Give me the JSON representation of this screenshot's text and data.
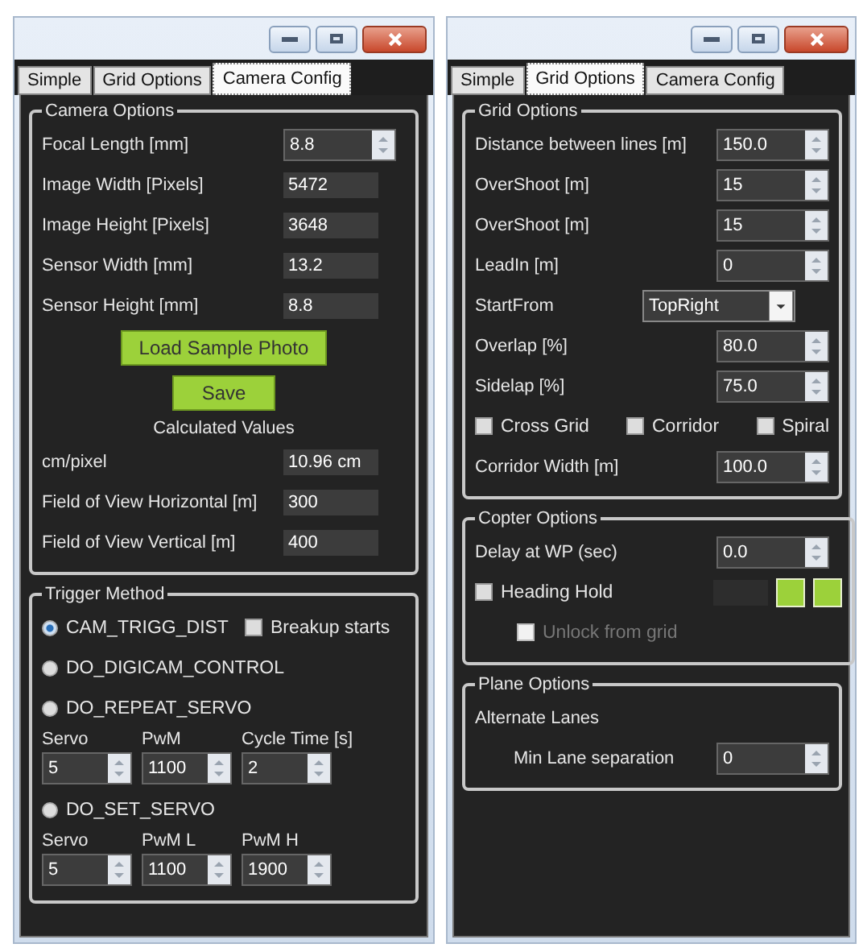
{
  "windows": [
    {
      "tabs": [
        {
          "label": "Simple",
          "selected": false
        },
        {
          "label": "Grid Options",
          "selected": false
        },
        {
          "label": "Camera Config",
          "selected": true
        }
      ],
      "groups": [
        {
          "title": "Camera Options",
          "rows": [
            {
              "kind": "spin",
              "label": "Focal Length [mm]",
              "value": "8.8"
            },
            {
              "kind": "field",
              "label": "Image Width [Pixels]",
              "value": "5472"
            },
            {
              "kind": "field",
              "label": "Image Height [Pixels]",
              "value": "3648"
            },
            {
              "kind": "field",
              "label": "Sensor Width [mm]",
              "value": "13.2"
            },
            {
              "kind": "field",
              "label": "Sensor Height [mm]",
              "value": "8.8"
            },
            {
              "kind": "button",
              "label": "Load Sample Photo"
            },
            {
              "kind": "button",
              "label": "Save"
            },
            {
              "kind": "caption",
              "label": "Calculated Values"
            },
            {
              "kind": "field",
              "label": "cm/pixel",
              "value": "10.96 cm"
            },
            {
              "kind": "field",
              "label": "Field of View Horizontal [m]",
              "value": "300"
            },
            {
              "kind": "field",
              "label": "Field of View Vertical [m]",
              "value": "400"
            }
          ]
        },
        {
          "title": "Trigger Method",
          "rows": [
            {
              "kind": "radio",
              "label": "CAM_TRIGG_DIST",
              "selected": true,
              "check": {
                "label": "Breakup starts",
                "checked": false
              }
            },
            {
              "kind": "radio",
              "label": "DO_DIGICAM_CONTROL",
              "selected": false
            },
            {
              "kind": "radio",
              "label": "DO_REPEAT_SERVO",
              "selected": false
            },
            {
              "kind": "spins",
              "items": [
                {
                  "label": "Servo",
                  "value": "5"
                },
                {
                  "label": "PwM",
                  "value": "1100"
                },
                {
                  "label": "Cycle Time [s]",
                  "value": "2"
                }
              ]
            },
            {
              "kind": "radio",
              "label": "DO_SET_SERVO",
              "selected": false
            },
            {
              "kind": "spins",
              "items": [
                {
                  "label": "Servo",
                  "value": "5"
                },
                {
                  "label": "PwM L",
                  "value": "1100"
                },
                {
                  "label": "PwM H",
                  "value": "1900"
                }
              ]
            }
          ]
        }
      ]
    },
    {
      "tabs": [
        {
          "label": "Simple",
          "selected": false
        },
        {
          "label": "Grid Options",
          "selected": true
        },
        {
          "label": "Camera Config",
          "selected": false
        }
      ],
      "groups": [
        {
          "title": "Grid Options",
          "rows": [
            {
              "kind": "spin",
              "label": "Distance between lines [m]",
              "value": "150.0"
            },
            {
              "kind": "spin",
              "label": "OverShoot [m]",
              "value": "15"
            },
            {
              "kind": "spin",
              "label": "OverShoot [m]",
              "value": "15"
            },
            {
              "kind": "spin",
              "label": "LeadIn [m]",
              "value": "0"
            },
            {
              "kind": "combo",
              "label": "StartFrom",
              "value": "TopRight"
            },
            {
              "kind": "spin",
              "label": "Overlap [%]",
              "value": "80.0"
            },
            {
              "kind": "spin",
              "label": "Sidelap [%]",
              "value": "75.0"
            },
            {
              "kind": "checks",
              "items": [
                {
                  "label": "Cross Grid",
                  "checked": false
                },
                {
                  "label": "Corridor",
                  "checked": false
                },
                {
                  "label": "Spiral",
                  "checked": false
                }
              ]
            },
            {
              "kind": "spin",
              "label": "Corridor Width [m]",
              "value": "100.0"
            }
          ]
        },
        {
          "title": "Copter Options",
          "rows": [
            {
              "kind": "spin",
              "label": "Delay at WP (sec)",
              "value": "0.0"
            },
            {
              "kind": "heading_hold",
              "label": "Heading Hold",
              "checked": false
            },
            {
              "kind": "check",
              "label": "Unlock from grid",
              "checked": false,
              "disabled": true
            }
          ]
        },
        {
          "title": "Plane Options",
          "rows": [
            {
              "kind": "text",
              "label": "Alternate Lanes"
            },
            {
              "kind": "spin",
              "label": "Min Lane separation",
              "value": "0",
              "indent": true
            }
          ]
        }
      ]
    }
  ]
}
